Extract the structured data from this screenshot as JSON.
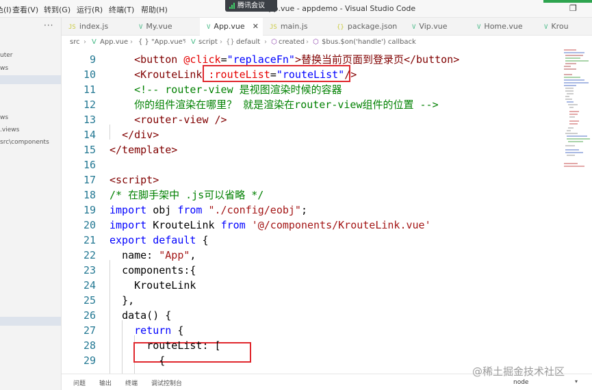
{
  "window": {
    "title": "App.vue - appdemo - Visual Studio Code",
    "menu": [
      "色(I)",
      "查看(V)",
      "转到(G)",
      "运行(R)",
      "终端(T)",
      "帮助(H)"
    ],
    "overlay_label": "腾讯会议"
  },
  "sidebar": {
    "items": [
      "uter",
      "ws",
      "ws",
      ".views",
      "src\\components"
    ]
  },
  "tabs": [
    {
      "label": "index.js",
      "icon": "JS",
      "color": "#cbcb41"
    },
    {
      "label": "My.vue",
      "icon": "V",
      "color": "#41b883"
    },
    {
      "label": "App.vue",
      "icon": "V",
      "color": "#41b883"
    },
    {
      "label": "main.js",
      "icon": "JS",
      "color": "#cbcb41"
    },
    {
      "label": "package.json",
      "icon": "{}",
      "color": "#cbcb41"
    },
    {
      "label": "Vip.vue",
      "icon": "V",
      "color": "#41b883"
    },
    {
      "label": "Home.vue",
      "icon": "V",
      "color": "#41b883"
    },
    {
      "label": "Krou",
      "icon": "V",
      "color": "#41b883"
    }
  ],
  "breadcrumb": [
    "src",
    "App.vue",
    "{ } \"App.vue\"",
    "script",
    "default",
    "created",
    "$bus.$on('handle') callback"
  ],
  "code_lines": [
    {
      "n": "9",
      "s": [
        [
          "    ",
          ""
        ],
        [
          "<button ",
          "t-tag"
        ],
        [
          "@click",
          "t-attr"
        ],
        [
          "=",
          "t-txt"
        ],
        [
          "\"replaceFn\"",
          "t-str"
        ],
        [
          ">替换当前页面到登录页</button>",
          "t-tag"
        ]
      ]
    },
    {
      "n": "10",
      "s": [
        [
          "    ",
          ""
        ],
        [
          "<KrouteLink ",
          "t-tag"
        ],
        [
          ":routeList",
          "t-attr"
        ],
        [
          "=",
          "t-txt"
        ],
        [
          "\"routeList\"",
          "t-str"
        ],
        [
          "/>",
          "t-tag"
        ]
      ]
    },
    {
      "n": "11",
      "s": [
        [
          "    ",
          ""
        ],
        [
          "<!-- router-view 是视图渲染时候的容器",
          "t-com"
        ]
      ]
    },
    {
      "n": "12",
      "s": [
        [
          "    ",
          ""
        ],
        [
          "你的组件渲染在哪里？ 就是渲染在router-view组件的位置 -->",
          "t-com"
        ]
      ]
    },
    {
      "n": "13",
      "s": [
        [
          "    ",
          ""
        ],
        [
          "<router-view />",
          "t-tag"
        ]
      ]
    },
    {
      "n": "14",
      "s": [
        [
          "  ",
          ""
        ],
        [
          "</div>",
          "t-tag"
        ]
      ]
    },
    {
      "n": "15",
      "s": [
        [
          "",
          ""
        ],
        [
          "</template>",
          "t-tag"
        ]
      ]
    },
    {
      "n": "16",
      "s": [
        [
          "",
          ""
        ]
      ]
    },
    {
      "n": "17",
      "s": [
        [
          "",
          ""
        ],
        [
          "<script>",
          "t-tag"
        ]
      ]
    },
    {
      "n": "18",
      "s": [
        [
          "",
          ""
        ],
        [
          "/* 在脚手架中 .js可以省略 */",
          "t-com"
        ]
      ]
    },
    {
      "n": "19",
      "s": [
        [
          "",
          ""
        ],
        [
          "import",
          "t-kw"
        ],
        [
          " obj ",
          "t-txt"
        ],
        [
          "from",
          "t-kw"
        ],
        [
          " ",
          "t-txt"
        ],
        [
          "\"./config/eobj\"",
          "t-str2"
        ],
        [
          ";",
          "t-txt"
        ]
      ]
    },
    {
      "n": "20",
      "s": [
        [
          "",
          ""
        ],
        [
          "import",
          "t-kw"
        ],
        [
          " KrouteLink ",
          "t-txt"
        ],
        [
          "from",
          "t-kw"
        ],
        [
          " ",
          "t-txt"
        ],
        [
          "'@/components/KrouteLink.vue'",
          "t-str2"
        ]
      ]
    },
    {
      "n": "21",
      "s": [
        [
          "",
          ""
        ],
        [
          "export",
          "t-kw"
        ],
        [
          " ",
          "t-txt"
        ],
        [
          "default",
          "t-kw"
        ],
        [
          " {",
          "t-txt"
        ]
      ]
    },
    {
      "n": "22",
      "s": [
        [
          "  ",
          ""
        ],
        [
          "name: ",
          "t-txt"
        ],
        [
          "\"App\"",
          "t-str2"
        ],
        [
          ",",
          "t-txt"
        ]
      ]
    },
    {
      "n": "23",
      "s": [
        [
          "  ",
          ""
        ],
        [
          "components:{",
          "t-txt"
        ]
      ]
    },
    {
      "n": "24",
      "s": [
        [
          "    ",
          ""
        ],
        [
          "KrouteLink",
          "t-txt"
        ]
      ]
    },
    {
      "n": "25",
      "s": [
        [
          "  ",
          ""
        ],
        [
          "},",
          "t-txt"
        ]
      ]
    },
    {
      "n": "26",
      "s": [
        [
          "  ",
          ""
        ],
        [
          "data() {",
          "t-txt"
        ]
      ]
    },
    {
      "n": "27",
      "s": [
        [
          "    ",
          ""
        ],
        [
          "return",
          "t-kw"
        ],
        [
          " {",
          "t-txt"
        ]
      ]
    },
    {
      "n": "28",
      "s": [
        [
          "      ",
          ""
        ],
        [
          "routeList: [",
          "t-txt"
        ]
      ]
    },
    {
      "n": "29",
      "s": [
        [
          "        ",
          ""
        ],
        [
          "{",
          "t-txt"
        ]
      ]
    }
  ],
  "panel_tabs": [
    "问题",
    "输出",
    "终端",
    "调试控制台"
  ],
  "terminal_label": "node",
  "watermark": "@稀土掘金技术社区"
}
